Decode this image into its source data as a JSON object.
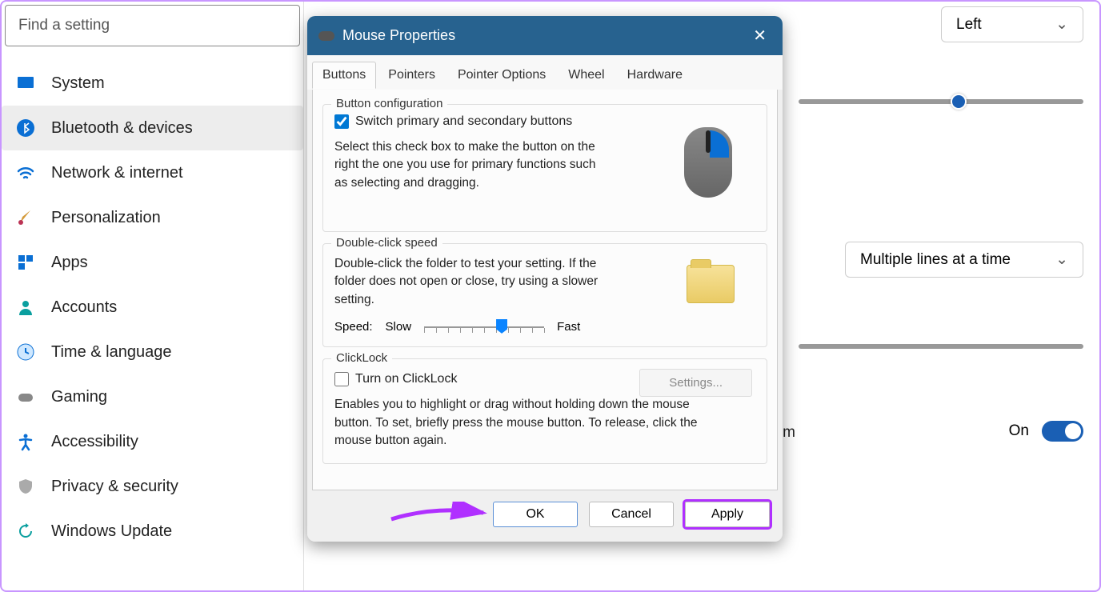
{
  "search": {
    "placeholder": "Find a setting"
  },
  "nav": {
    "items": [
      {
        "label": "System"
      },
      {
        "label": "Bluetooth & devices"
      },
      {
        "label": "Network & internet"
      },
      {
        "label": "Personalization"
      },
      {
        "label": "Apps"
      },
      {
        "label": "Accounts"
      },
      {
        "label": "Time & language"
      },
      {
        "label": "Gaming"
      },
      {
        "label": "Accessibility"
      },
      {
        "label": "Privacy & security"
      },
      {
        "label": "Windows Update"
      }
    ]
  },
  "main": {
    "dropdown_primary": "Left",
    "dropdown_scroll": "Multiple lines at a time",
    "toggle_label": "On",
    "truncated_letter": "m"
  },
  "dialog": {
    "title": "Mouse Properties",
    "tabs": {
      "buttons": "Buttons",
      "pointers": "Pointers",
      "pointer_options": "Pointer Options",
      "wheel": "Wheel",
      "hardware": "Hardware"
    },
    "group_button_config": {
      "title": "Button configuration",
      "checkbox_label": "Switch primary and secondary buttons",
      "description": "Select this check box to make the button on the right the one you use for primary functions such as selecting and dragging."
    },
    "group_doubleclick": {
      "title": "Double-click speed",
      "description": "Double-click the folder to test your setting. If the folder does not open or close, try using a slower setting.",
      "speed_label": "Speed:",
      "slow_label": "Slow",
      "fast_label": "Fast"
    },
    "group_clicklock": {
      "title": "ClickLock",
      "checkbox_label": "Turn on ClickLock",
      "settings_btn": "Settings...",
      "description": "Enables you to highlight or drag without holding down the mouse button. To set, briefly press the mouse button. To release, click the mouse button again."
    },
    "buttons": {
      "ok": "OK",
      "cancel": "Cancel",
      "apply": "Apply"
    }
  }
}
